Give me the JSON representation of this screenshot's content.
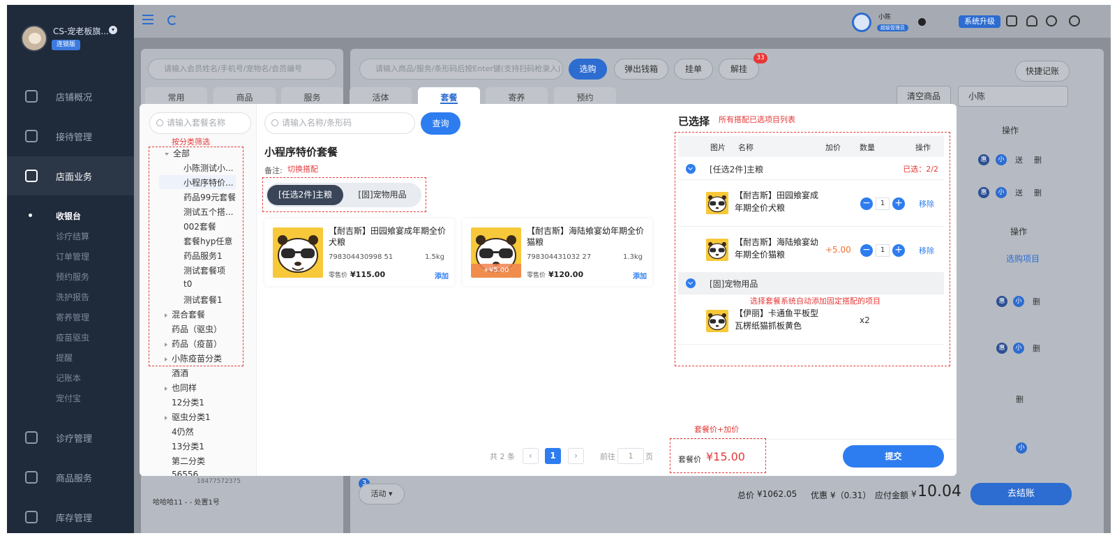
{
  "sidebar": {
    "store_name": "CS-宠老板旗...",
    "edition_badge": "连锁版",
    "items": [
      {
        "label": "店铺概况",
        "icon": "monitor-icon"
      },
      {
        "label": "接待管理",
        "icon": "reception-icon"
      },
      {
        "label": "店面业务",
        "icon": "shop-icon"
      },
      {
        "label": "诊疗管理",
        "icon": "medical-icon"
      },
      {
        "label": "商品服务",
        "icon": "product-icon"
      },
      {
        "label": "库存管理",
        "icon": "inventory-icon"
      }
    ],
    "sub_items": [
      "收银台",
      "诊疗结算",
      "订单管理",
      "预约服务",
      "洗护报告",
      "寄养管理",
      "疫苗驱虫",
      "提醒",
      "记账本",
      "宠付宝"
    ]
  },
  "topbar": {
    "user_name": "小陈",
    "user_role": "超级管理员",
    "upgrade_label": "系统升级"
  },
  "background": {
    "member_search_placeholder": "请输入会员姓名/手机号/宠物名/会员编号",
    "product_search_placeholder": "请输入商品/服务/条形码后按Enter键(支持扫码枪录入)",
    "select_button": "选购",
    "cashbox_button": "弹出钱箱",
    "hold_button": "挂单",
    "unhold_button": "解挂",
    "unhold_badge": "33",
    "quick_note_button": "快捷记账",
    "clear_button": "清空商品",
    "staff_select": "小陈",
    "col_operation": "操作",
    "purchase_item_link": "选购项目",
    "tag_discount": "惠",
    "tag_small": "小",
    "tag_gift": "送",
    "tag_delete": "删",
    "member_phone": "18477572375",
    "member_line": "哈哈哈11 - - 处置1号",
    "activity_badge": "3",
    "activity_button": "活动",
    "total_label": "总价",
    "total_value": "¥1062.05",
    "discount_label": "优惠",
    "discount_value": "¥（0.31）",
    "payable_label": "应付金额",
    "payable_currency": "¥",
    "payable_value": "10.04",
    "checkout_button": "去结账"
  },
  "tabs": [
    {
      "label": "常用",
      "active": false
    },
    {
      "label": "商品",
      "active": false
    },
    {
      "label": "服务",
      "active": false
    },
    {
      "label": "活体",
      "active": false
    },
    {
      "label": "套餐",
      "active": true
    },
    {
      "label": "寄养",
      "active": false
    },
    {
      "label": "预约",
      "active": false
    }
  ],
  "modal": {
    "package_search_placeholder": "请输入套餐名称",
    "category_filter_note": "按分类筛选",
    "tree": [
      {
        "label": "全部",
        "level": 0,
        "arrow": "open"
      },
      {
        "label": "小陈测试小...",
        "level": 1
      },
      {
        "label": "小程序特价...",
        "level": 1,
        "selected": true
      },
      {
        "label": "药品99元套餐",
        "level": 1
      },
      {
        "label": "测试五个搭...",
        "level": 1
      },
      {
        "label": "002套餐",
        "level": 1
      },
      {
        "label": "套餐hyp任意",
        "level": 1
      },
      {
        "label": "药品服务1",
        "level": 1
      },
      {
        "label": "测试套餐项",
        "level": 1
      },
      {
        "label": "t0",
        "level": 1
      },
      {
        "label": "测试套餐1",
        "level": 1
      },
      {
        "label": "混合套餐",
        "level": 0,
        "arrow": "closed"
      },
      {
        "label": "药品（驱虫）",
        "level": 0
      },
      {
        "label": "药品（疫苗）",
        "level": 0,
        "arrow": "closed"
      },
      {
        "label": "小陈疫苗分类",
        "level": 0,
        "arrow": "closed"
      },
      {
        "label": "酒酒",
        "level": 0
      },
      {
        "label": "也同样",
        "level": 0,
        "arrow": "closed"
      },
      {
        "label": "12分类1",
        "level": 0
      },
      {
        "label": "驱虫分类1",
        "level": 0,
        "arrow": "closed"
      },
      {
        "label": "4仍然",
        "level": 0
      },
      {
        "label": "13分类1",
        "level": 0
      },
      {
        "label": "第二分类",
        "level": 0
      },
      {
        "label": "56556",
        "level": 0
      }
    ],
    "item_search_placeholder": "请输入名称/条形码",
    "query_button": "查询",
    "package_title": "小程序特价套餐",
    "remark_label": "备注:",
    "switch_note": "切换搭配",
    "segments": [
      "[任选2件]主粮",
      "[固]宠物用品"
    ],
    "products": [
      {
        "name": "【耐吉斯】田园飨宴成年期全价犬粮",
        "code": "798304430998 51",
        "spec": "1.5kg",
        "price_label": "零售价",
        "price": "¥115.00",
        "add_label": "添加",
        "extra": ""
      },
      {
        "name": "【耐吉斯】海陆飨宴幼年期全价猫粮",
        "code": "798304431032 27",
        "spec": "1.3kg",
        "price_label": "零售价",
        "price": "¥120.00",
        "add_label": "添加",
        "extra": "+¥5.00"
      }
    ],
    "pager": {
      "total_text": "共 2 条",
      "current": "1",
      "goto_label": "前往",
      "goto_value": "1",
      "page_unit": "页"
    },
    "selected_title": "已选择",
    "selected_note": "所有搭配已选项目列表",
    "table_headers": [
      "图片",
      "名称",
      "加价",
      "数量",
      "操作"
    ],
    "group1": {
      "label": "[任选2件]主粮",
      "count": "已选：2/2"
    },
    "selected_items": [
      {
        "name": "【耐吉斯】田园飨宴成年期全价犬粮",
        "add_price": "",
        "qty": "1",
        "remove": "移除"
      },
      {
        "name": "【耐吉斯】海陆飨宴幼年期全价猫粮",
        "add_price": "+5.00",
        "qty": "1",
        "remove": "移除"
      }
    ],
    "group2": {
      "label": "[固]宠物用品"
    },
    "fixed_note": "选择套餐系统自动添加固定搭配的项目",
    "fixed_item": {
      "name": "【伊丽】卡通鱼平板型瓦楞纸猫抓板黄色",
      "qty": "x2"
    },
    "price_note": "套餐价+加价",
    "package_price_label": "套餐价",
    "package_price": "¥15.00",
    "submit_button": "提交"
  },
  "colors": {
    "primary": "#2d7df0",
    "sidebar_bg": "#1f2a3b",
    "annotation_red": "#e63838",
    "mascot_yellow": "#f7c93a"
  }
}
